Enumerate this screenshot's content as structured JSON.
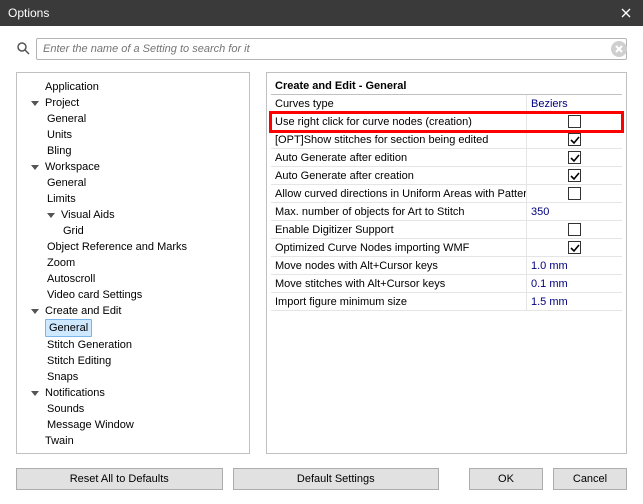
{
  "window": {
    "title": "Options"
  },
  "search": {
    "placeholder": "Enter the name of a Setting to search for it"
  },
  "tree": {
    "application": "Application",
    "project": "Project",
    "project_general": "General",
    "project_units": "Units",
    "project_bling": "Bling",
    "workspace": "Workspace",
    "workspace_general": "General",
    "workspace_limits": "Limits",
    "visual_aids": "Visual Aids",
    "visual_grid": "Grid",
    "object_ref": "Object Reference and Marks",
    "zoom": "Zoom",
    "autoscroll": "Autoscroll",
    "video_card": "Video card Settings",
    "create_edit": "Create and Edit",
    "ce_general": "General",
    "ce_stitch_gen": "Stitch Generation",
    "ce_stitch_edit": "Stitch Editing",
    "ce_snaps": "Snaps",
    "notifications": "Notifications",
    "sounds": "Sounds",
    "msg_window": "Message Window",
    "twain": "Twain"
  },
  "grid": {
    "header": "Create and Edit - General",
    "rows": [
      {
        "label": "Curves type",
        "value_type": "text",
        "value": "Beziers",
        "highlight": false
      },
      {
        "label": "Use right click for curve nodes (creation)",
        "value_type": "check",
        "checked": false,
        "highlight": true
      },
      {
        "label": "[OPT]Show stitches for section being edited",
        "value_type": "check",
        "checked": true,
        "highlight": false
      },
      {
        "label": "Auto Generate after edition",
        "value_type": "check",
        "checked": true,
        "highlight": false
      },
      {
        "label": "Auto Generate after creation",
        "value_type": "check",
        "checked": true,
        "highlight": false
      },
      {
        "label": "Allow curved directions in Uniform Areas with Pattern",
        "value_type": "check",
        "checked": false,
        "highlight": false
      },
      {
        "label": "Max. number of objects for Art to Stitch",
        "value_type": "text",
        "value": "350",
        "highlight": false
      },
      {
        "label": "Enable Digitizer Support",
        "value_type": "check",
        "checked": false,
        "highlight": false
      },
      {
        "label": "Optimized Curve Nodes importing WMF",
        "value_type": "check",
        "checked": true,
        "highlight": false
      },
      {
        "label": "Move nodes with Alt+Cursor keys",
        "value_type": "text",
        "value": "1.0 mm",
        "highlight": false
      },
      {
        "label": "Move stitches with Alt+Cursor keys",
        "value_type": "text",
        "value": "0.1 mm",
        "highlight": false
      },
      {
        "label": "Import figure minimum size",
        "value_type": "text",
        "value": "1.5 mm",
        "highlight": false
      }
    ]
  },
  "buttons": {
    "reset_all": "Reset All to Defaults",
    "default_settings": "Default Settings",
    "ok": "OK",
    "cancel": "Cancel"
  }
}
